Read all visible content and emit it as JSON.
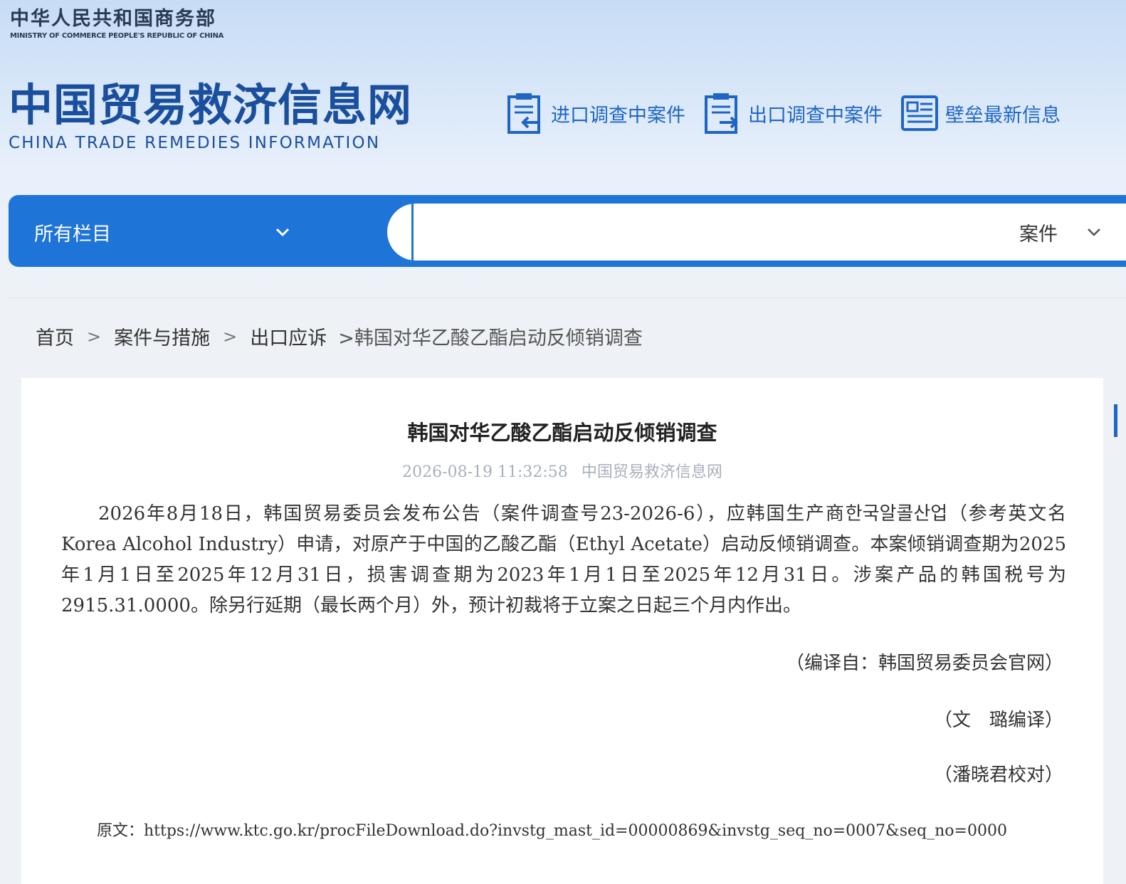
{
  "ministry": {
    "name_cn": "中华人民共和国商务部",
    "name_en": "MINISTRY OF COMMERCE PEOPLE'S REPUBLIC OF CHINA"
  },
  "site": {
    "name_cn": "中国贸易救济信息网",
    "name_en": "CHINA TRADE REMEDIES INFORMATION"
  },
  "quick_links": [
    {
      "label": "进口调查中案件",
      "icon": "import-case-icon"
    },
    {
      "label": "出口调查中案件",
      "icon": "export-case-icon"
    },
    {
      "label": "壁垒最新信息",
      "icon": "barrier-news-icon"
    }
  ],
  "search": {
    "category": "所有栏目",
    "type": "案件",
    "query": ""
  },
  "breadcrumb": {
    "items": [
      "首页",
      "案件与措施",
      "出口应诉"
    ],
    "current": ">韩国对华乙酸乙酯启动反倾销调查"
  },
  "article": {
    "title": "韩国对华乙酸乙酯启动反倾销调查",
    "datetime": "2026-08-19 11:32:58",
    "source_site": "中国贸易救济信息网",
    "body": "2026年8月18日，韩国贸易委员会发布公告（案件调查号23-2026-6），应韩国生产商한국알콜산업（参考英文名Korea Alcohol Industry）申请，对原产于中国的乙酸乙酯（Ethyl Acetate）启动反倾销调查。本案倾销调查期为2025年1月1日至2025年12月31日，损害调查期为2023年1月1日至2025年12月31日。涉案产品的韩国税号为2915.31.0000。除另行延期（最长两个月）外，预计初裁将于立案之日起三个月内作出。",
    "credit_compiled": "（编译自：韩国贸易委员会官网）",
    "credit_translator": "（文　璐编译）",
    "credit_proofreader": "（潘晓君校对）",
    "original_url": "原文：https://www.ktc.go.kr/procFileDownload.do?invstg_mast_id=00000869&invstg_seq_no=0007&seq_no=0000"
  },
  "colors": {
    "brand_blue": "#1f74d7",
    "logo_blue": "#1a4f9e",
    "link_blue": "#1f66c4"
  }
}
